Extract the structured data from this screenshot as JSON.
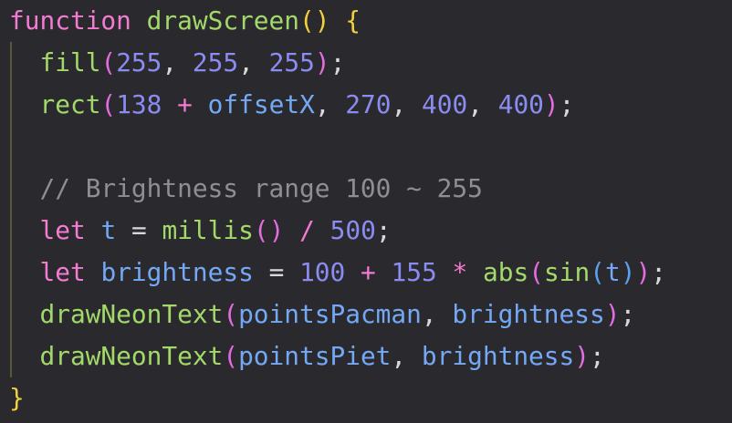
{
  "editor": {
    "lines": [
      [
        {
          "t": "function",
          "c": "kw"
        },
        {
          "t": " ",
          "c": "punc"
        },
        {
          "t": "drawScreen",
          "c": "fn"
        },
        {
          "t": "()",
          "c": "paren-y"
        },
        {
          "t": " ",
          "c": "punc"
        },
        {
          "t": "{",
          "c": "paren-y"
        }
      ],
      [
        {
          "t": "  ",
          "c": "punc"
        },
        {
          "t": "fill",
          "c": "fn"
        },
        {
          "t": "(",
          "c": "paren-p"
        },
        {
          "t": "255",
          "c": "num"
        },
        {
          "t": ", ",
          "c": "punc"
        },
        {
          "t": "255",
          "c": "num"
        },
        {
          "t": ", ",
          "c": "punc"
        },
        {
          "t": "255",
          "c": "num"
        },
        {
          "t": ")",
          "c": "paren-p"
        },
        {
          "t": ";",
          "c": "punc"
        }
      ],
      [
        {
          "t": "  ",
          "c": "punc"
        },
        {
          "t": "rect",
          "c": "fn"
        },
        {
          "t": "(",
          "c": "paren-p"
        },
        {
          "t": "138",
          "c": "num"
        },
        {
          "t": " ",
          "c": "punc"
        },
        {
          "t": "+",
          "c": "op"
        },
        {
          "t": " ",
          "c": "punc"
        },
        {
          "t": "offsetX",
          "c": "var"
        },
        {
          "t": ", ",
          "c": "punc"
        },
        {
          "t": "270",
          "c": "num"
        },
        {
          "t": ", ",
          "c": "punc"
        },
        {
          "t": "400",
          "c": "num"
        },
        {
          "t": ", ",
          "c": "punc"
        },
        {
          "t": "400",
          "c": "num"
        },
        {
          "t": ")",
          "c": "paren-p"
        },
        {
          "t": ";",
          "c": "punc"
        }
      ],
      [],
      [
        {
          "t": "  ",
          "c": "punc"
        },
        {
          "t": "// Brightness range 100 ~ 255",
          "c": "comment"
        }
      ],
      [
        {
          "t": "  ",
          "c": "punc"
        },
        {
          "t": "let",
          "c": "kw"
        },
        {
          "t": " ",
          "c": "punc"
        },
        {
          "t": "t",
          "c": "var"
        },
        {
          "t": " ",
          "c": "punc"
        },
        {
          "t": "=",
          "c": "punc"
        },
        {
          "t": " ",
          "c": "punc"
        },
        {
          "t": "millis",
          "c": "fn"
        },
        {
          "t": "()",
          "c": "paren-p"
        },
        {
          "t": " ",
          "c": "punc"
        },
        {
          "t": "/",
          "c": "op"
        },
        {
          "t": " ",
          "c": "punc"
        },
        {
          "t": "500",
          "c": "num"
        },
        {
          "t": ";",
          "c": "punc"
        }
      ],
      [
        {
          "t": "  ",
          "c": "punc"
        },
        {
          "t": "let",
          "c": "kw"
        },
        {
          "t": " ",
          "c": "punc"
        },
        {
          "t": "brightness",
          "c": "var"
        },
        {
          "t": " ",
          "c": "punc"
        },
        {
          "t": "=",
          "c": "punc"
        },
        {
          "t": " ",
          "c": "punc"
        },
        {
          "t": "100",
          "c": "num"
        },
        {
          "t": " ",
          "c": "punc"
        },
        {
          "t": "+",
          "c": "op"
        },
        {
          "t": " ",
          "c": "punc"
        },
        {
          "t": "155",
          "c": "num"
        },
        {
          "t": " ",
          "c": "punc"
        },
        {
          "t": "*",
          "c": "op"
        },
        {
          "t": " ",
          "c": "punc"
        },
        {
          "t": "abs",
          "c": "fn"
        },
        {
          "t": "(",
          "c": "paren-p"
        },
        {
          "t": "sin",
          "c": "fn"
        },
        {
          "t": "(",
          "c": "paren-b"
        },
        {
          "t": "t",
          "c": "var"
        },
        {
          "t": ")",
          "c": "paren-b"
        },
        {
          "t": ")",
          "c": "paren-p"
        },
        {
          "t": ";",
          "c": "punc"
        }
      ],
      [
        {
          "t": "  ",
          "c": "punc"
        },
        {
          "t": "drawNeonText",
          "c": "fn"
        },
        {
          "t": "(",
          "c": "paren-p"
        },
        {
          "t": "pointsPacman",
          "c": "var"
        },
        {
          "t": ", ",
          "c": "punc"
        },
        {
          "t": "brightness",
          "c": "var"
        },
        {
          "t": ")",
          "c": "paren-p"
        },
        {
          "t": ";",
          "c": "punc"
        }
      ],
      [
        {
          "t": "  ",
          "c": "punc"
        },
        {
          "t": "drawNeonText",
          "c": "fn"
        },
        {
          "t": "(",
          "c": "paren-p"
        },
        {
          "t": "pointsPiet",
          "c": "var"
        },
        {
          "t": ", ",
          "c": "punc"
        },
        {
          "t": "brightness",
          "c": "var"
        },
        {
          "t": ")",
          "c": "paren-p"
        },
        {
          "t": ";",
          "c": "punc"
        }
      ],
      [
        {
          "t": "}",
          "c": "paren-y"
        }
      ]
    ]
  }
}
